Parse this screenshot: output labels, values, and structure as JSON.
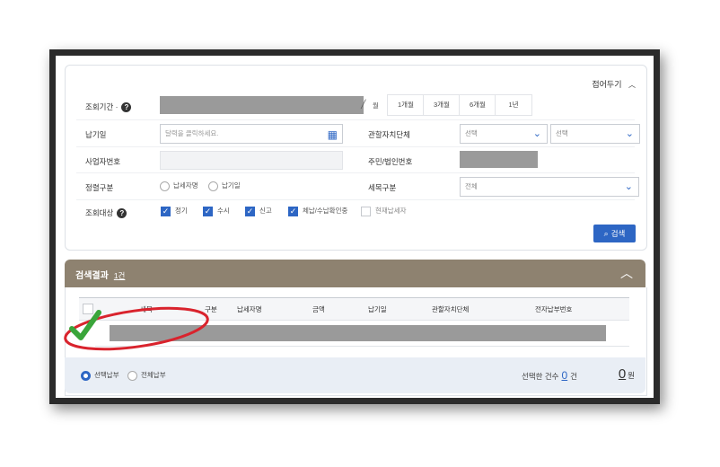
{
  "header": {
    "collapse_label": "접어두기"
  },
  "search": {
    "period_label": "조회기간 ·",
    "period_suffix": "월",
    "period_tabs": [
      "1개월",
      "3개월",
      "6개월",
      "1년"
    ],
    "due_date_label": "납기일",
    "due_date_placeholder": "달력을 클릭하세요.",
    "jurisdiction_label": "관할자치단체",
    "jurisdiction_select_1": "선택",
    "jurisdiction_select_2": "선택",
    "bizno_label": "사업자번호",
    "resident_no_label": "주민/법인번호",
    "classify_label": "정렬구분",
    "classify_options": [
      "납세자명",
      "납기일"
    ],
    "tax_item_label": "세목구분",
    "tax_item_value": "전체",
    "target_label": "조회대상",
    "target_options": [
      {
        "label": "정기",
        "checked": true
      },
      {
        "label": "수시",
        "checked": true
      },
      {
        "label": "신고",
        "checked": true
      },
      {
        "label": "체납/수납확인중",
        "checked": true
      },
      {
        "label": "현재납세자",
        "checked": false
      }
    ],
    "search_button": "검색"
  },
  "results": {
    "title": "검색결과",
    "count": "1건",
    "columns": [
      "세목",
      "구분",
      "납세자명",
      "금액",
      "납기일",
      "관할자치단체",
      "전자납부번호"
    ]
  },
  "footer": {
    "pay_options": [
      {
        "label": "선택납부",
        "selected": true
      },
      {
        "label": "전체납부",
        "selected": false
      }
    ],
    "selected_count_label": "선택한 건수",
    "selected_count": "0",
    "selected_count_unit": "건",
    "amount": "0",
    "amount_unit": "원"
  },
  "colors": {
    "accent": "#2d66c4",
    "results_bar": "#8e8270",
    "annotation": "#d9232d",
    "check": "#3aa53a"
  }
}
